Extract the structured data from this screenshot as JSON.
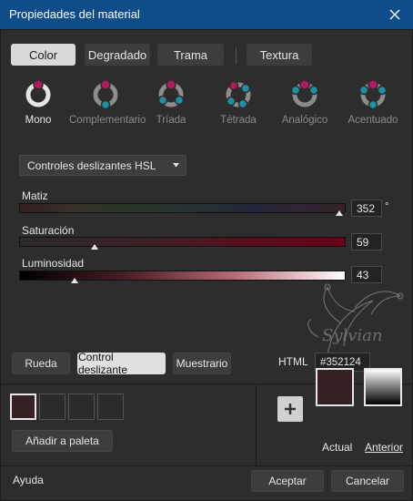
{
  "window": {
    "title": "Propiedades del material"
  },
  "tabs": [
    {
      "label": "Color",
      "active": true
    },
    {
      "label": "Degradado",
      "active": false
    },
    {
      "label": "Trama",
      "active": false
    },
    {
      "label": "Textura",
      "active": false
    }
  ],
  "harmonies": [
    {
      "label": "Mono",
      "active": true
    },
    {
      "label": "Complementario",
      "active": false
    },
    {
      "label": "Tríada",
      "active": false
    },
    {
      "label": "Tétrada",
      "active": false
    },
    {
      "label": "Analógico",
      "active": false
    },
    {
      "label": "Acentuado",
      "active": false
    }
  ],
  "mode_dropdown": {
    "selected": "Controles deslizantes HSL"
  },
  "sliders": {
    "hue": {
      "label": "Matiz",
      "value": "352",
      "unit": "°",
      "fraction": 0.98
    },
    "saturation": {
      "label": "Saturación",
      "value": "59",
      "fraction": 0.23
    },
    "luminosity": {
      "label": "Luminosidad",
      "value": "43",
      "fraction": 0.17
    }
  },
  "view_buttons": [
    {
      "label": "Rueda",
      "active": false
    },
    {
      "label": "Control deslizante",
      "active": true
    },
    {
      "label": "Muestrario",
      "active": false
    }
  ],
  "html": {
    "label": "HTML",
    "value": "#352124"
  },
  "palette": {
    "add_label": "Añadir a paleta"
  },
  "preview": {
    "current_label": "Actual",
    "previous_label": "Anterior",
    "current_color": "#352124"
  },
  "footer": {
    "help": "Ayuda",
    "ok": "Aceptar",
    "cancel": "Cancelar"
  },
  "watermark": {
    "text": "Sylvian"
  },
  "colors": {
    "titlebar": "#0f4c8a",
    "magenta_dot": "#b5185e",
    "teal_dot": "#1f8fa6"
  }
}
